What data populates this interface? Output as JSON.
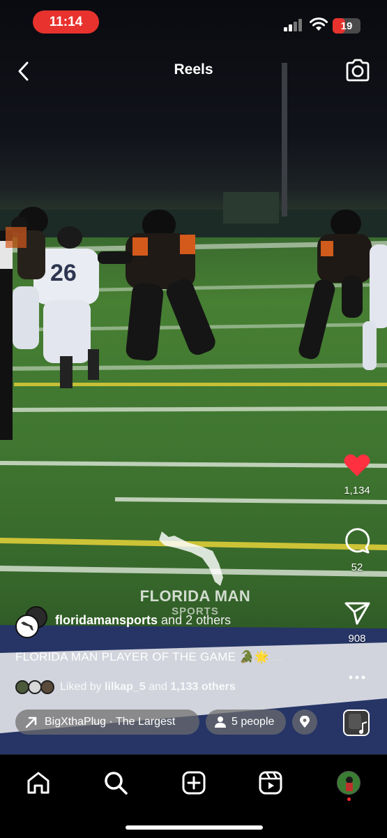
{
  "status_bar": {
    "time": "11:14",
    "battery": "19",
    "battery_level": 0.19
  },
  "header": {
    "title": "Reels"
  },
  "video": {
    "jersey_number": "26"
  },
  "watermark": {
    "text": "FLORIDA MAN",
    "subtext": "SPORTS"
  },
  "actions": {
    "likes": "1,134",
    "comments": "52",
    "shares": "908"
  },
  "author": {
    "username": "floridamansports",
    "collab": "and 2 others"
  },
  "caption": {
    "text": "FLORIDA MAN PLAYER OF THE GAME 🐊🌟",
    "more": " ..."
  },
  "liked_by": {
    "prefix": "Liked by ",
    "user": "lilkap_5",
    "middle": " and ",
    "others": "1,133 others"
  },
  "chips": {
    "audio": "BigXthaPlug · The Largest",
    "people": "5 people"
  },
  "colors": {
    "accent": "#e8322e",
    "like": "#ff3040"
  }
}
